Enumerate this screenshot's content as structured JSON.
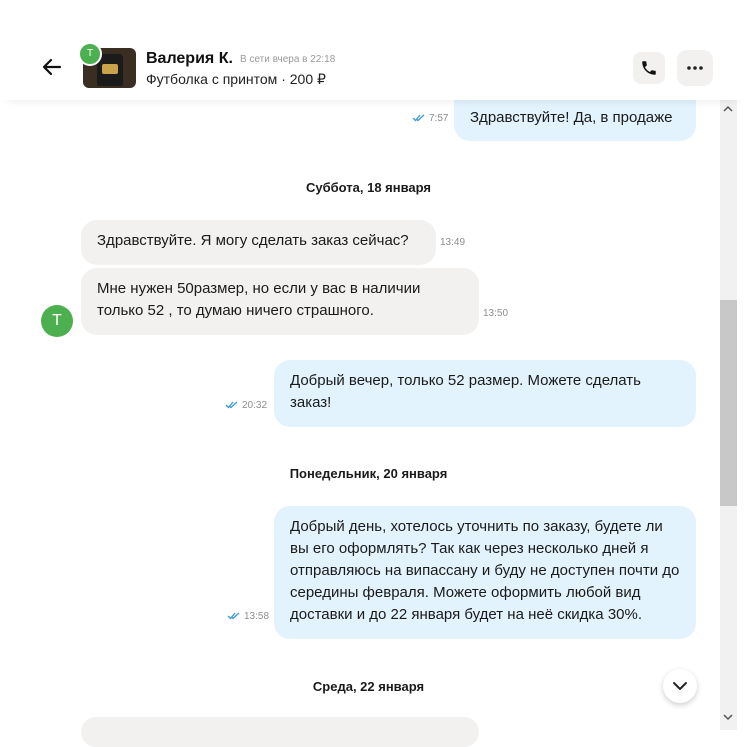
{
  "header": {
    "contact_name": "Валерия К.",
    "status": "В сети вчера в 22:18",
    "product_title": "Футболка с принтом · 200 ₽",
    "avatar_letter": "Т"
  },
  "messages": [
    {
      "dir": "out",
      "text": "Здравствуйте! Да, в продаже",
      "time": "7:57",
      "read": true
    },
    {
      "dir": "in",
      "text": "Здравствуйте. Я могу сделать заказ сейчас?",
      "time": "13:49"
    },
    {
      "dir": "in",
      "text": "Мне нужен 50размер, но если у вас в наличии только 52 , то думаю ничего страшного.",
      "time": "13:50"
    },
    {
      "dir": "out",
      "text": "Добрый вечер, только 52 размер. Можете сделать заказ!",
      "time": "20:32",
      "read": true
    },
    {
      "dir": "out",
      "text": "Добрый день, хотелось уточнить по заказу, будете ли вы его оформлять? Так как через несколько дней я отправляюсь на випассану и буду не доступен почти до середины февраля. Можете оформить любой вид доставки и до 22 января будет на неё скидка 30%.",
      "time": "13:58",
      "read": true
    }
  ],
  "dates": [
    "Суббота, 18 января",
    "Понедельник, 20 января",
    "Среда, 22 января"
  ],
  "sender_avatar_letter": "Т",
  "colors": {
    "incoming": "#f2f1ef",
    "outgoing": "#e3f3fd",
    "avatar": "#4caf50",
    "read_ticks": "#3a9ad9"
  }
}
